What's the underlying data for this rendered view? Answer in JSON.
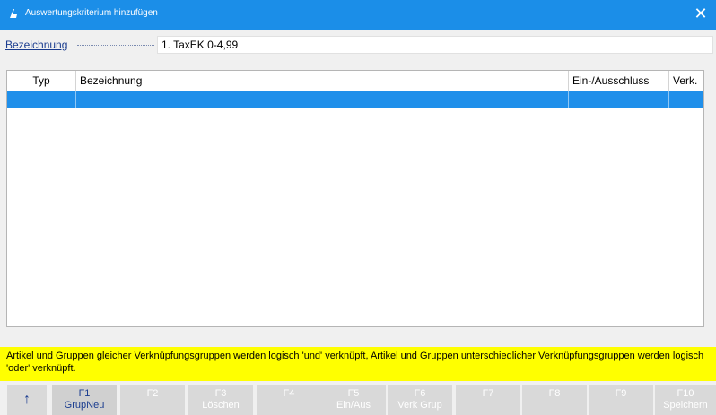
{
  "window": {
    "title": "Auswertungskriterium hinzufügen",
    "close_glyph": "✕",
    "accent": "#1b8ee8"
  },
  "name_field": {
    "label": "Bezeichnung",
    "value": "1. TaxEK 0-4,99"
  },
  "grid": {
    "columns": [
      "Typ",
      "Bezeichnung",
      "Ein-/Ausschluss",
      "Verk."
    ],
    "selected_row_color": "#1f8fea",
    "rows": [
      {
        "typ": "",
        "bezeichnung": "",
        "ein_ausschluss": "",
        "verk": ""
      }
    ]
  },
  "hint": {
    "text": "Artikel und Gruppen gleicher Verknüpfungsgruppen werden logisch 'und' verknüpft, Artikel und Gruppen unterschiedlicher Verknüpfungsgruppen werden logisch 'oder' verknüpft.",
    "background": "#ffff00"
  },
  "function_keys": {
    "up_icon": "↑",
    "keys": [
      {
        "key": "F1",
        "label": "GrupNeu",
        "enabled": true
      },
      {
        "key": "F2",
        "label": "",
        "enabled": false
      },
      {
        "key": "F3",
        "label": "Löschen",
        "enabled": false
      },
      {
        "key": "F4",
        "label": "",
        "enabled": false
      },
      {
        "key": "F5",
        "label": "Ein/Aus",
        "enabled": false
      },
      {
        "key": "F6",
        "label": "Verk Grup",
        "enabled": false
      },
      {
        "key": "F7",
        "label": "",
        "enabled": false
      },
      {
        "key": "F8",
        "label": "",
        "enabled": false
      },
      {
        "key": "F9",
        "label": "",
        "enabled": false
      },
      {
        "key": "F10",
        "label": "Speichern",
        "enabled": false
      }
    ]
  }
}
